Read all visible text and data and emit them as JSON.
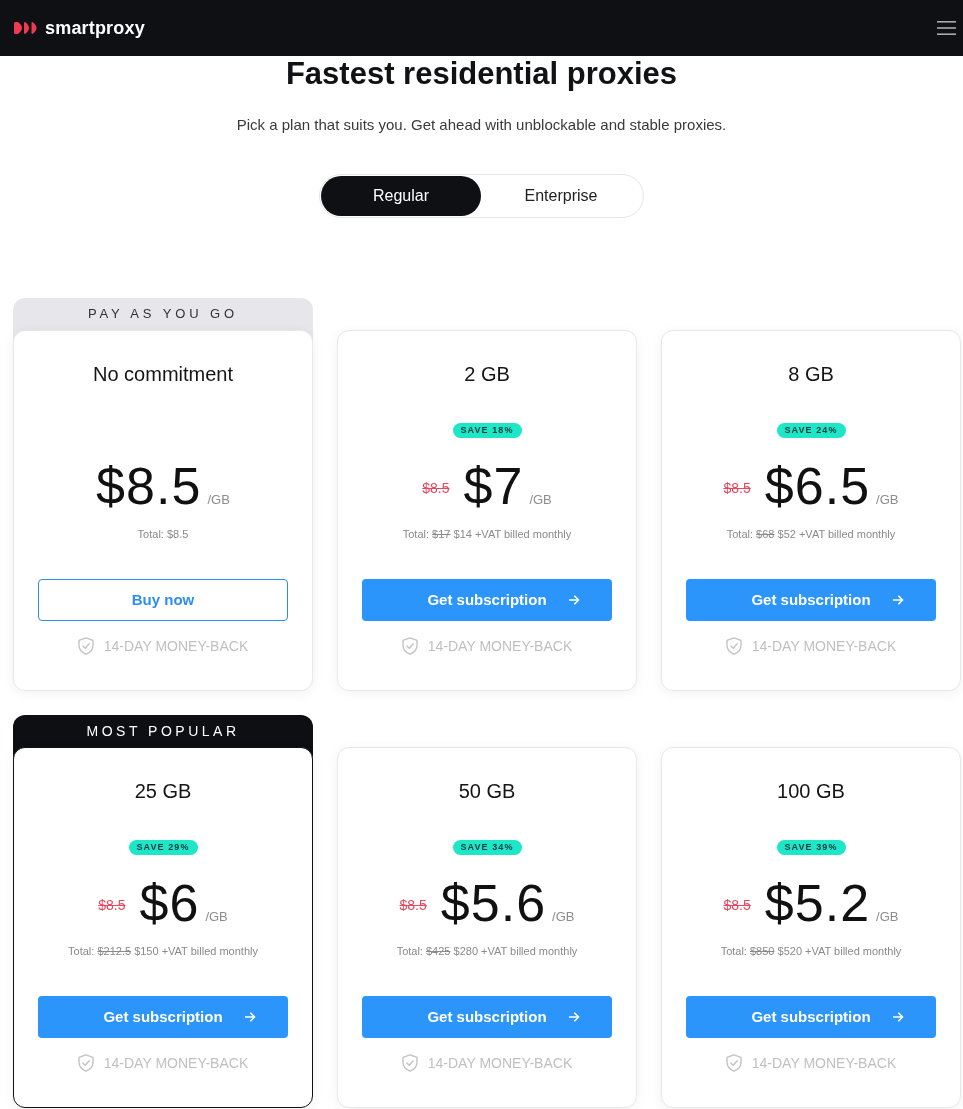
{
  "header": {
    "logo_text": "smartproxy"
  },
  "hero": {
    "title": "Fastest residential proxies",
    "subtitle": "Pick a plan that suits you. Get ahead with unblockable and stable proxies."
  },
  "plan_tabs": [
    {
      "label": "Regular",
      "selected": true
    },
    {
      "label": "Enterprise",
      "selected": false
    }
  ],
  "plans": [
    {
      "ribbon": {
        "label": "PAY AS YOU GO",
        "kind": "light"
      },
      "title": "No commitment",
      "price": "$8.5",
      "unit": "/GB",
      "total_prefix": "Total:",
      "total": "$8.5",
      "button": {
        "label": "Buy now",
        "kind": "outline"
      },
      "guarantee": "14-DAY MONEY-BACK"
    },
    {
      "title": "2 GB",
      "badge": "SAVE 18%",
      "old_price": "$8.5",
      "price": "$7",
      "unit": "/GB",
      "total_prefix": "Total:",
      "old_total": "$17",
      "total": "$14 +VAT billed monthly",
      "button": {
        "label": "Get subscription",
        "kind": "solid"
      },
      "guarantee": "14-DAY MONEY-BACK"
    },
    {
      "title": "8 GB",
      "badge": "SAVE 24%",
      "old_price": "$8.5",
      "price": "$6.5",
      "unit": "/GB",
      "total_prefix": "Total:",
      "old_total": "$68",
      "total": "$52 +VAT billed monthly",
      "button": {
        "label": "Get subscription",
        "kind": "solid"
      },
      "guarantee": "14-DAY MONEY-BACK"
    },
    {
      "ribbon": {
        "label": "MOST POPULAR",
        "kind": "dark"
      },
      "title": "25 GB",
      "badge": "SAVE 29%",
      "old_price": "$8.5",
      "price": "$6",
      "unit": "/GB",
      "total_prefix": "Total:",
      "old_total": "$212.5",
      "total": "$150 +VAT billed monthly",
      "button": {
        "label": "Get subscription",
        "kind": "solid"
      },
      "guarantee": "14-DAY MONEY-BACK"
    },
    {
      "title": "50 GB",
      "badge": "SAVE 34%",
      "old_price": "$8.5",
      "price": "$5.6",
      "unit": "/GB",
      "total_prefix": "Total:",
      "old_total": "$425",
      "total": "$280 +VAT billed monthly",
      "button": {
        "label": "Get subscription",
        "kind": "solid"
      },
      "guarantee": "14-DAY MONEY-BACK"
    },
    {
      "title": "100 GB",
      "badge": "SAVE 39%",
      "old_price": "$8.5",
      "price": "$5.2",
      "unit": "/GB",
      "total_prefix": "Total:",
      "old_total": "$850",
      "total": "$520 +VAT billed monthly",
      "button": {
        "label": "Get subscription",
        "kind": "solid"
      },
      "guarantee": "14-DAY MONEY-BACK"
    }
  ]
}
